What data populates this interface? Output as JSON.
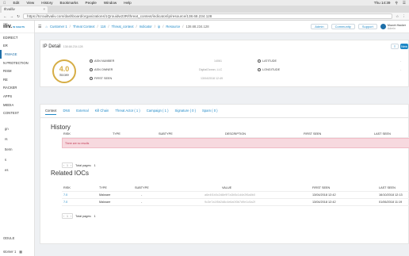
{
  "macbar": {
    "menus": [
      "Edit",
      "View",
      "History",
      "Bookmarks",
      "People",
      "Window",
      "Help"
    ],
    "clock": "Thu 14:39",
    "app_initial": "s"
  },
  "browser": {
    "tab_label": "Iltvalliv",
    "url": "https://tcrouiltvaliv.com/dashboard/organizations/1Qrouidw23R/threat_context/indicator/ip/resource/138.68.234.128"
  },
  "sidebar": {
    "brand": "iliv.",
    "brand_sub": "IN SIGHTS",
    "items": [
      "EDIRECT",
      "ER",
      "RWAGE",
      "N PROTECTION",
      "RISM",
      "RE",
      "RACKER",
      "APPS",
      "MEDIA",
      "CONTEXT"
    ],
    "active_index": 2,
    "sub_items": [
      "gn",
      "rs",
      "tterm",
      "s",
      "es"
    ],
    "module": "ODULE",
    "footer": "stomer 1"
  },
  "topbar": {
    "breadcrumb": [
      "Customer 1",
      "Threat Context",
      "116",
      "Threat_context",
      "Indicator",
      "ip",
      "Resource",
      "138.68.234.128"
    ],
    "buttons": [
      "Admin",
      "Community",
      "Support"
    ],
    "user_name": "Muzoh Hacker",
    "user_sub": "Admin"
  },
  "header": {
    "title": "IP Detail",
    "title_sub": "138.68.234.128",
    "score_value": "4.0",
    "score_label": "Score",
    "labels": {
      "asn_number": "ASN NUMBER",
      "asn_owner": "ASN OWNER",
      "first_seen": "FIRST SEEN",
      "latitude": "LATITUDE",
      "longitude": "LONGITUDE"
    },
    "values": {
      "asn_number": "14061",
      "asn_owner": "DigitalOcean, LLC",
      "first_seen": "13/04/2018 12:49",
      "latitude": "-",
      "longitude": "-"
    },
    "icon_buttons": [
      "≡",
      "New"
    ]
  },
  "tabs": [
    "Context",
    "DNS",
    "External",
    "Kill Chain",
    "Threat Actor ( 1 )",
    "Campaign ( 1 )",
    "Signature ( 0 )",
    "Spam ( 0 )"
  ],
  "history": {
    "title": "History",
    "columns": [
      "RISK",
      "TYPE",
      "SUBTYPE",
      "DESCRIPTION",
      "FIRST SEEN",
      "LAST SEEN"
    ],
    "no_results": "There are no results",
    "page": "1",
    "total_pages_label": "Total pages:",
    "total_pages": "1"
  },
  "related": {
    "title": "Related IOCs",
    "columns": [
      "RISK",
      "TYPE",
      "SUBTYPE",
      "VALUE",
      "FIRST SEEN",
      "LAST SEEN"
    ],
    "rows": [
      {
        "risk": "7.0",
        "type": "Malware",
        "subtype": "-",
        "value": "a6e4f1b0c2d8e9f7a3b5c1d4e2f6a8b0",
        "first": "13/04/2018 12:42",
        "last": "16/10/2018 12:13"
      },
      {
        "risk": "7.0",
        "type": "Malware",
        "subtype": "-",
        "value": "9c3e7a1f5b2d8c4e6a0f3b7d9e1c5a2f",
        "first": "13/04/2018 12:42",
        "last": "01/06/2018 11:19"
      }
    ],
    "page": "1",
    "total_pages_label": "Total pages:",
    "total_pages": "1"
  },
  "colors": {
    "accent": "#1e88c7",
    "score": "#d6ad45",
    "error_bg": "#f7d9df"
  }
}
